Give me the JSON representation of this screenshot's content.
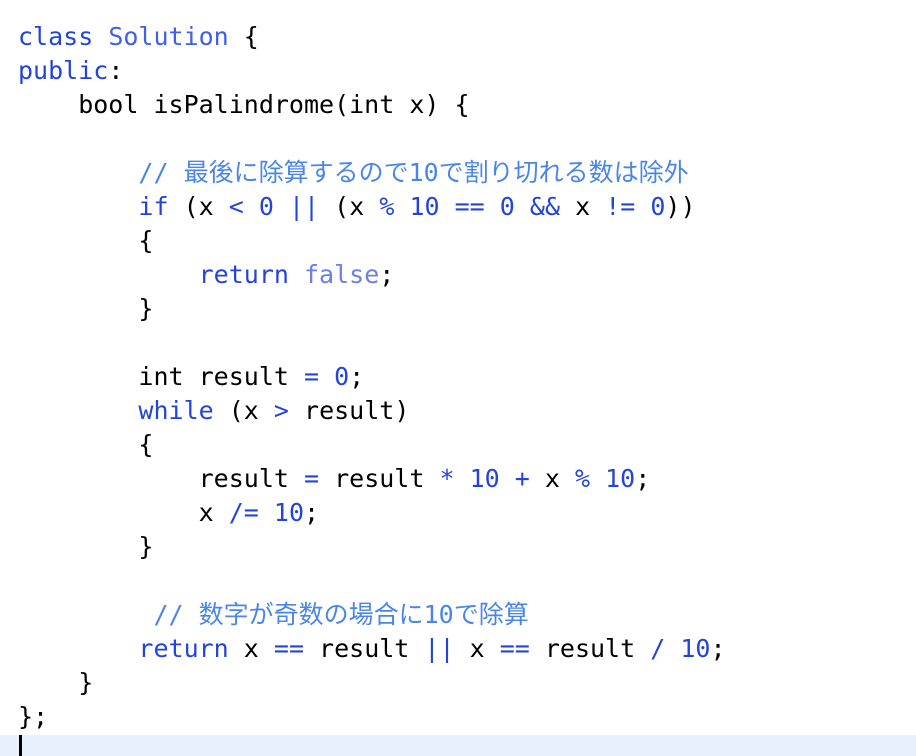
{
  "editor": {
    "language": "cpp",
    "background_color": "#ffffff",
    "current_line_highlight_color": "#e8f0fd",
    "caret_color": "#000000",
    "font_size_px": 25,
    "line_height_px": 34,
    "colors": {
      "keyword": "#2244dd",
      "type_name": "#4060e8",
      "literal": "#6a7fe8",
      "number": "#2244dd",
      "operator": "#2244dd",
      "comment": "#4a86e8",
      "plain": "#000000"
    }
  },
  "code": {
    "full_text": "class Solution {\npublic:\n    bool isPalindrome(int x) {\n\n        // 最後に除算するので10で割り切れる数は除外\n        if (x < 0 || (x % 10 == 0 && x != 0))\n        {\n            return false;\n        }\n\n        int result = 0;\n        while (x > result)\n        {\n            result = result * 10 + x % 10;\n            x /= 10;\n        }\n\n         // 数字が奇数の場合に10で除算\n        return x == result || x == result / 10;\n    }\n};",
    "lines": [
      {
        "n": 1,
        "text": "class Solution {",
        "tokens": [
          {
            "t": "class",
            "c": "kw"
          },
          {
            "t": " ",
            "c": "pl"
          },
          {
            "t": "Solution",
            "c": "type"
          },
          {
            "t": " {",
            "c": "pl"
          }
        ]
      },
      {
        "n": 2,
        "text": "public:",
        "tokens": [
          {
            "t": "public",
            "c": "kw"
          },
          {
            "t": ":",
            "c": "pl"
          }
        ]
      },
      {
        "n": 3,
        "text": "    bool isPalindrome(int x) {",
        "tokens": [
          {
            "t": "    bool isPalindrome(int x) {",
            "c": "pl"
          }
        ]
      },
      {
        "n": 4,
        "text": "",
        "tokens": []
      },
      {
        "n": 5,
        "text": "        // 最後に除算するので10で割り切れる数は除外",
        "tokens": [
          {
            "t": "        ",
            "c": "pl"
          },
          {
            "t": "// 最後に除算するので10で割り切れる数は除外",
            "c": "cmt"
          }
        ]
      },
      {
        "n": 6,
        "text": "        if (x < 0 || (x % 10 == 0 && x != 0))",
        "tokens": [
          {
            "t": "        ",
            "c": "pl"
          },
          {
            "t": "if",
            "c": "kw"
          },
          {
            "t": " (x ",
            "c": "pl"
          },
          {
            "t": "<",
            "c": "op"
          },
          {
            "t": " ",
            "c": "pl"
          },
          {
            "t": "0",
            "c": "num"
          },
          {
            "t": " ",
            "c": "pl"
          },
          {
            "t": "||",
            "c": "op"
          },
          {
            "t": " (x ",
            "c": "pl"
          },
          {
            "t": "%",
            "c": "op"
          },
          {
            "t": " ",
            "c": "pl"
          },
          {
            "t": "10",
            "c": "num"
          },
          {
            "t": " ",
            "c": "pl"
          },
          {
            "t": "==",
            "c": "op"
          },
          {
            "t": " ",
            "c": "pl"
          },
          {
            "t": "0",
            "c": "num"
          },
          {
            "t": " ",
            "c": "pl"
          },
          {
            "t": "&&",
            "c": "op"
          },
          {
            "t": " x ",
            "c": "pl"
          },
          {
            "t": "!=",
            "c": "op"
          },
          {
            "t": " ",
            "c": "pl"
          },
          {
            "t": "0",
            "c": "num"
          },
          {
            "t": "))",
            "c": "pl"
          }
        ]
      },
      {
        "n": 7,
        "text": "        {",
        "tokens": [
          {
            "t": "        {",
            "c": "pl"
          }
        ]
      },
      {
        "n": 8,
        "text": "            return false;",
        "tokens": [
          {
            "t": "            ",
            "c": "pl"
          },
          {
            "t": "return",
            "c": "kw"
          },
          {
            "t": " ",
            "c": "pl"
          },
          {
            "t": "false",
            "c": "lit"
          },
          {
            "t": ";",
            "c": "pl"
          }
        ]
      },
      {
        "n": 9,
        "text": "        }",
        "tokens": [
          {
            "t": "        }",
            "c": "pl"
          }
        ]
      },
      {
        "n": 10,
        "text": "",
        "tokens": []
      },
      {
        "n": 11,
        "text": "        int result = 0;",
        "tokens": [
          {
            "t": "        int result ",
            "c": "pl"
          },
          {
            "t": "=",
            "c": "op"
          },
          {
            "t": " ",
            "c": "pl"
          },
          {
            "t": "0",
            "c": "num"
          },
          {
            "t": ";",
            "c": "pl"
          }
        ]
      },
      {
        "n": 12,
        "text": "        while (x > result)",
        "tokens": [
          {
            "t": "        ",
            "c": "pl"
          },
          {
            "t": "while",
            "c": "kw"
          },
          {
            "t": " (x ",
            "c": "pl"
          },
          {
            "t": ">",
            "c": "op"
          },
          {
            "t": " result)",
            "c": "pl"
          }
        ]
      },
      {
        "n": 13,
        "text": "        {",
        "tokens": [
          {
            "t": "        {",
            "c": "pl"
          }
        ]
      },
      {
        "n": 14,
        "text": "            result = result * 10 + x % 10;",
        "tokens": [
          {
            "t": "            result ",
            "c": "pl"
          },
          {
            "t": "=",
            "c": "op"
          },
          {
            "t": " result ",
            "c": "pl"
          },
          {
            "t": "*",
            "c": "op"
          },
          {
            "t": " ",
            "c": "pl"
          },
          {
            "t": "10",
            "c": "num"
          },
          {
            "t": " ",
            "c": "pl"
          },
          {
            "t": "+",
            "c": "op"
          },
          {
            "t": " x ",
            "c": "pl"
          },
          {
            "t": "%",
            "c": "op"
          },
          {
            "t": " ",
            "c": "pl"
          },
          {
            "t": "10",
            "c": "num"
          },
          {
            "t": ";",
            "c": "pl"
          }
        ]
      },
      {
        "n": 15,
        "text": "            x /= 10;",
        "tokens": [
          {
            "t": "            x ",
            "c": "pl"
          },
          {
            "t": "/=",
            "c": "op"
          },
          {
            "t": " ",
            "c": "pl"
          },
          {
            "t": "10",
            "c": "num"
          },
          {
            "t": ";",
            "c": "pl"
          }
        ]
      },
      {
        "n": 16,
        "text": "        }",
        "tokens": [
          {
            "t": "        }",
            "c": "pl"
          }
        ]
      },
      {
        "n": 17,
        "text": "",
        "tokens": []
      },
      {
        "n": 18,
        "text": "         // 数字が奇数の場合に10で除算",
        "tokens": [
          {
            "t": "         ",
            "c": "pl"
          },
          {
            "t": "// 数字が奇数の場合に10で除算",
            "c": "cmt"
          }
        ]
      },
      {
        "n": 19,
        "text": "        return x == result || x == result / 10;",
        "tokens": [
          {
            "t": "        ",
            "c": "pl"
          },
          {
            "t": "return",
            "c": "kw"
          },
          {
            "t": " x ",
            "c": "pl"
          },
          {
            "t": "==",
            "c": "op"
          },
          {
            "t": " result ",
            "c": "pl"
          },
          {
            "t": "||",
            "c": "op"
          },
          {
            "t": " x ",
            "c": "pl"
          },
          {
            "t": "==",
            "c": "op"
          },
          {
            "t": " result ",
            "c": "pl"
          },
          {
            "t": "/",
            "c": "op"
          },
          {
            "t": " ",
            "c": "pl"
          },
          {
            "t": "10",
            "c": "num"
          },
          {
            "t": ";",
            "c": "pl"
          }
        ]
      },
      {
        "n": 20,
        "text": "    }",
        "tokens": [
          {
            "t": "    }",
            "c": "pl"
          }
        ]
      },
      {
        "n": 21,
        "text": "};",
        "tokens": [
          {
            "t": "};",
            "c": "pl"
          }
        ]
      }
    ]
  }
}
